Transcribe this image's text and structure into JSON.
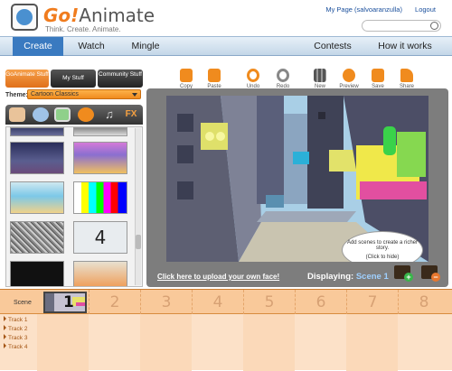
{
  "header": {
    "logo_text": "Go!",
    "logo_text2": "Animate",
    "tagline": "Think. Create. Animate.",
    "my_page": "My Page (salvoaranzulla)",
    "logout": "Logout"
  },
  "nav": {
    "create": "Create",
    "watch": "Watch",
    "mingle": "Mingle",
    "contests": "Contests",
    "how": "How it works"
  },
  "library": {
    "tabs": [
      "GoAnimate Stuff",
      "My Stuff",
      "Community Stuff"
    ],
    "theme_label": "Theme:",
    "theme_value": "Cartoon Classics",
    "categories": [
      "characters-icon",
      "props-icon",
      "backgrounds-icon",
      "sound-icon",
      "music-icon",
      "effects-icon"
    ],
    "fx_label": "FX"
  },
  "thumbnail_number": "4",
  "toolbar": {
    "copy": "Copy",
    "paste": "Paste",
    "undo": "Undo",
    "redo": "Redo",
    "new": "New",
    "preview": "Preview",
    "save": "Save",
    "share": "Share"
  },
  "stage": {
    "upload_link": "Click here to upload your own face!",
    "displaying_label": "Displaying:",
    "displaying_value": "Scene 1",
    "bubble_text": "Add scenes to create a richer story.",
    "bubble_hide": "(Click to hide)"
  },
  "timeline": {
    "scene_label": "Scene",
    "scene_numbers": [
      "1",
      "2",
      "3",
      "4",
      "5",
      "6",
      "7",
      "8"
    ],
    "tracks": [
      "Track 1",
      "Track 2",
      "Track 3",
      "Track 4"
    ]
  },
  "colors": {
    "accent": "#3a7ac0",
    "orange": "#f08b1e",
    "timeline_bg": "#fce1c8"
  }
}
